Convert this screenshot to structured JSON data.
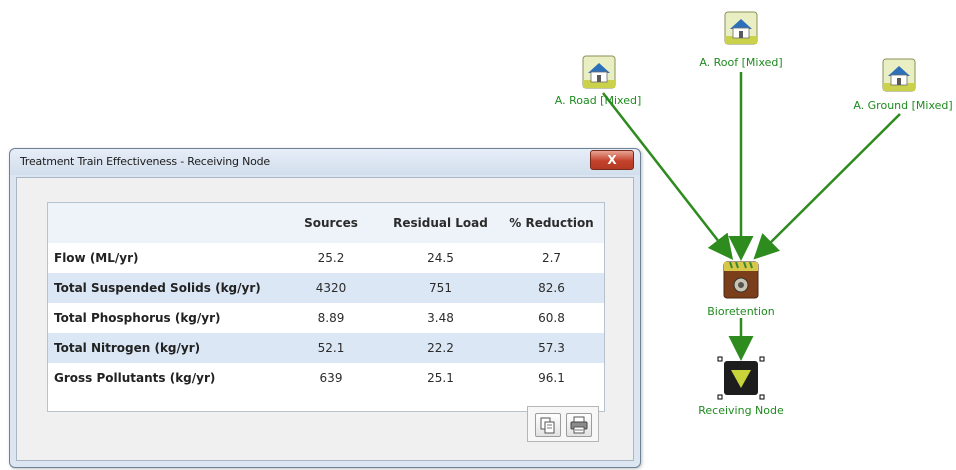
{
  "diagram": {
    "nodes": [
      {
        "id": "a-roof",
        "label": "A. Roof [Mixed]",
        "icon": "house-icon"
      },
      {
        "id": "a-road",
        "label": "A. Road [Mixed]",
        "icon": "house-icon"
      },
      {
        "id": "a-ground",
        "label": "A. Ground [Mixed]",
        "icon": "house-icon"
      },
      {
        "id": "bioretention",
        "label": "Bioretention",
        "icon": "bioretention-icon"
      },
      {
        "id": "receiving",
        "label": "Receiving Node",
        "icon": "receiving-node-icon"
      }
    ],
    "colors": {
      "link": "#2e8b1e",
      "label": "#1f8a1f"
    }
  },
  "dialog": {
    "title": "Treatment Train Effectiveness - Receiving Node",
    "close_label": "X",
    "table": {
      "headers": [
        "",
        "Sources",
        "Residual Load",
        "% Reduction"
      ],
      "rows": [
        {
          "label": "Flow (ML/yr)",
          "sources": "25.2",
          "residual": "24.5",
          "reduction": "2.7"
        },
        {
          "label": "Total Suspended Solids (kg/yr)",
          "sources": "4320",
          "residual": "751",
          "reduction": "82.6"
        },
        {
          "label": "Total Phosphorus (kg/yr)",
          "sources": "8.89",
          "residual": "3.48",
          "reduction": "60.8"
        },
        {
          "label": "Total Nitrogen (kg/yr)",
          "sources": "52.1",
          "residual": "22.2",
          "reduction": "57.3"
        },
        {
          "label": "Gross Pollutants (kg/yr)",
          "sources": "639",
          "residual": "25.1",
          "reduction": "96.1"
        }
      ]
    },
    "buttons": {
      "copy_icon": "copy-icon",
      "print_icon": "print-icon"
    }
  }
}
